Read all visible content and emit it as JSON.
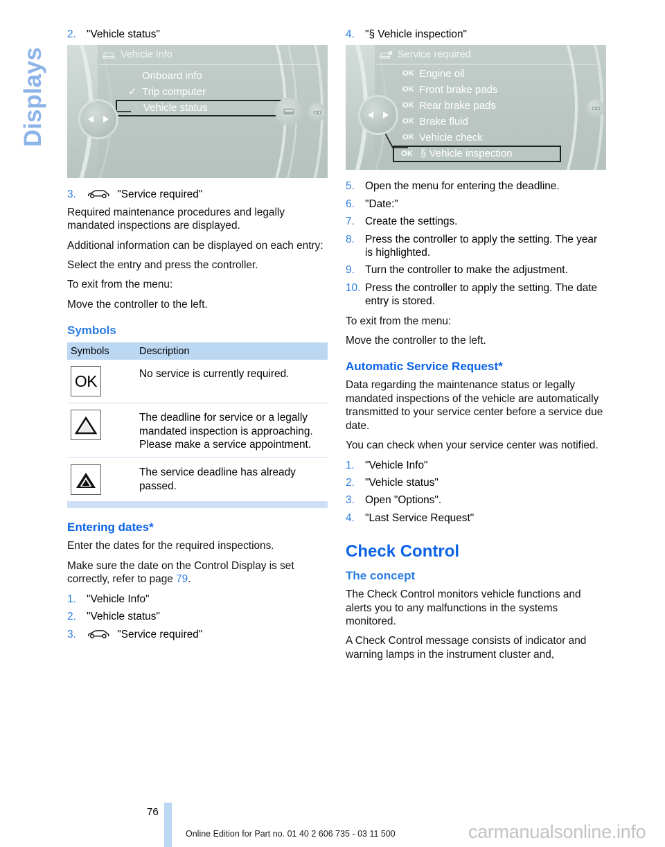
{
  "side_tab": {
    "label": "Displays"
  },
  "left_column": {
    "step2": {
      "num": "2.",
      "text": "\"Vehicle status\""
    },
    "display_vehicle_info": {
      "title": "Vehicle Info",
      "title_icon": "car-front-icon",
      "items": [
        {
          "label": "Onboard info",
          "marker": "",
          "selected": false
        },
        {
          "label": "Trip computer",
          "marker": "✓",
          "selected": false
        },
        {
          "label": "Vehicle status",
          "marker": "",
          "selected": true
        }
      ]
    },
    "step3": {
      "num": "3.",
      "icon": "car-side-icon",
      "text": "\"Service required\""
    },
    "para1": "Required maintenance procedures and legally mandated inspections are displayed.",
    "para2": "Additional information can be displayed on each entry:",
    "para3": "Select the entry and press the controller.",
    "para4": "To exit from the menu:",
    "para5": "Move the controller to the left.",
    "symbols_heading": "Symbols",
    "symbols_table": {
      "headers": [
        "Symbols",
        "Description"
      ],
      "rows": [
        {
          "symbol": "OK",
          "symbol_type": "ok-box",
          "description": "No service is currently required."
        },
        {
          "symbol": "△",
          "symbol_type": "triangle-outline",
          "description": "The deadline for service or a legally mandated inspection is approaching. Please make a service appointment."
        },
        {
          "symbol": "▲",
          "symbol_type": "triangle-filled",
          "description": "The service deadline has already passed."
        }
      ]
    },
    "entering_dates_heading": "Entering dates*",
    "entering_dates_p1": "Enter the dates for the required inspections.",
    "entering_dates_p2_a": "Make sure the date on the Control Display is set correctly, refer to page ",
    "entering_dates_p2_link": "79",
    "entering_dates_p2_b": ".",
    "entering_dates_steps": [
      {
        "num": "1.",
        "text": "\"Vehicle Info\""
      },
      {
        "num": "2.",
        "text": "\"Vehicle status\""
      },
      {
        "num": "3.",
        "text": "\"Service required\"",
        "icon": "car-side-icon"
      }
    ]
  },
  "right_column": {
    "step4": {
      "num": "4.",
      "text": "\"§ Vehicle inspection\""
    },
    "display_service_required": {
      "title": "Service required",
      "title_icon": "car-service-icon",
      "items": [
        {
          "status": "OK",
          "label": "Engine oil",
          "selected": false
        },
        {
          "status": "OK",
          "label": "Front brake pads",
          "selected": false
        },
        {
          "status": "OK",
          "label": "Rear brake pads",
          "selected": false
        },
        {
          "status": "OK",
          "label": "Brake fluid",
          "selected": false
        },
        {
          "status": "OK",
          "label": "Vehicle check",
          "selected": false
        },
        {
          "status": "OK",
          "label": "§ Vehicle inspection",
          "selected": true
        }
      ]
    },
    "steps": [
      {
        "num": "5.",
        "text": "Open the menu for entering the deadline."
      },
      {
        "num": "6.",
        "text": "\"Date:\""
      },
      {
        "num": "7.",
        "text": "Create the settings."
      },
      {
        "num": "8.",
        "text": "Press the controller to apply the setting. The year is highlighted."
      },
      {
        "num": "9.",
        "text": "Turn the controller to make the adjustment."
      },
      {
        "num": "10.",
        "text": "Press the controller to apply the setting. The date entry is stored."
      }
    ],
    "exit_line1": "To exit from the menu:",
    "exit_line2": "Move the controller to the left.",
    "asr_heading": "Automatic Service Request*",
    "asr_p1": "Data regarding the maintenance status or legally mandated inspections of the vehicle are automatically transmitted to your service center before a service due date.",
    "asr_p2": "You can check when your service center was notified.",
    "asr_steps": [
      {
        "num": "1.",
        "text": "\"Vehicle Info\""
      },
      {
        "num": "2.",
        "text": "\"Vehicle status\""
      },
      {
        "num": "3.",
        "text": "Open \"Options\"."
      },
      {
        "num": "4.",
        "text": "\"Last Service Request\""
      }
    ],
    "check_control_heading": "Check Control",
    "concept_heading": "The concept",
    "concept_p1": "The Check Control monitors vehicle functions and alerts you to any malfunctions in the systems monitored.",
    "concept_p2": "A Check Control message consists of indicator and warning lamps in the instrument cluster and,"
  },
  "footer": {
    "page_number": "76",
    "edition_text": "Online Edition for Part no. 01 40 2 606 735 - 03 11 500",
    "watermark": "carmanualsonline.info"
  },
  "colors": {
    "accent_blue": "#0a62e8",
    "link_blue": "#2b7de0",
    "tab_blue": "#8cb4e8",
    "table_header": "#bcd7f2",
    "display_bg": "#c3cecb"
  }
}
